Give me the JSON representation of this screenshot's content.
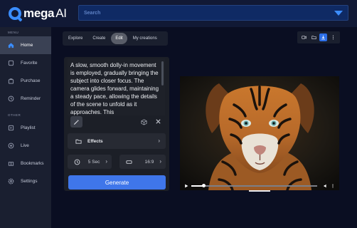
{
  "app": {
    "logo_text": "mega",
    "logo_suffix": "AI",
    "brand_color": "#3a8dff"
  },
  "search": {
    "placeholder": "Search"
  },
  "sidebar": {
    "section_menu": "MENU",
    "section_other": "OTHER",
    "menu_items": [
      {
        "label": "Home",
        "icon": "home-icon",
        "active": true
      },
      {
        "label": "Favorite",
        "icon": "favorite-icon"
      },
      {
        "label": "Purchase",
        "icon": "purchase-icon"
      },
      {
        "label": "Reminder",
        "icon": "reminder-icon"
      }
    ],
    "other_items": [
      {
        "label": "Playlist",
        "icon": "playlist-icon"
      },
      {
        "label": "Live",
        "icon": "live-icon"
      },
      {
        "label": "Bookmarks",
        "icon": "bookmark-icon"
      },
      {
        "label": "Settings",
        "icon": "settings-icon"
      }
    ]
  },
  "tabs": [
    {
      "label": "Explore"
    },
    {
      "label": "Create"
    },
    {
      "label": "Edit",
      "active": true
    },
    {
      "label": "My creations"
    }
  ],
  "toolbar": {
    "icons": [
      "video-icon",
      "folder-icon",
      "download-icon",
      "more-icon"
    ]
  },
  "prompt": {
    "text": "A slow, smooth dolly-in movement is employed, gradually bringing the subject into closer focus. The camera glides forward, maintaining a steady pace, allowing the details of the scene to unfold as it approaches. This"
  },
  "effects": {
    "label": "Effects"
  },
  "duration": {
    "label": "5 Sec"
  },
  "aspect_ratio": {
    "label": "16:9"
  },
  "generate": {
    "label": "Generate"
  },
  "player": {
    "progress_fraction": 0.1
  }
}
